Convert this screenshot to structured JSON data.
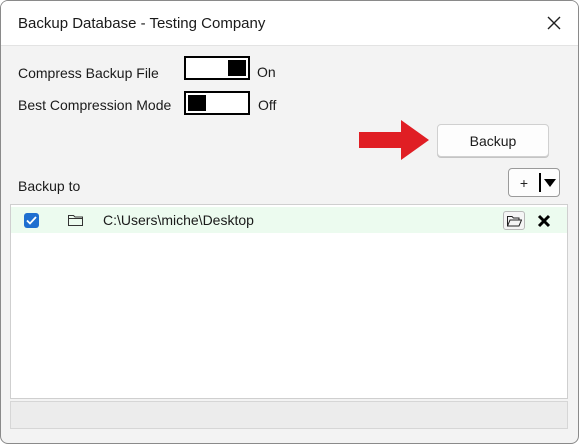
{
  "window": {
    "title": "Backup Database - Testing Company"
  },
  "options": {
    "compress": {
      "label": "Compress Backup File",
      "state": "On",
      "enabled": true
    },
    "best": {
      "label": "Best Compression Mode",
      "state": "Off",
      "enabled": false
    }
  },
  "actions": {
    "backup_label": "Backup",
    "add_label": "+"
  },
  "backup_to": {
    "label": "Backup to",
    "items": [
      {
        "checked": true,
        "path": "C:\\Users\\miche\\Desktop"
      }
    ]
  },
  "colors": {
    "accent": "#1f6fd0",
    "arrow": "#e01e24",
    "row_highlight": "#ecfbef"
  },
  "icons": [
    "close-icon",
    "arrow-right-icon",
    "chevron-down-icon",
    "check-icon",
    "folder-icon",
    "folder-open-icon",
    "delete-icon"
  ]
}
